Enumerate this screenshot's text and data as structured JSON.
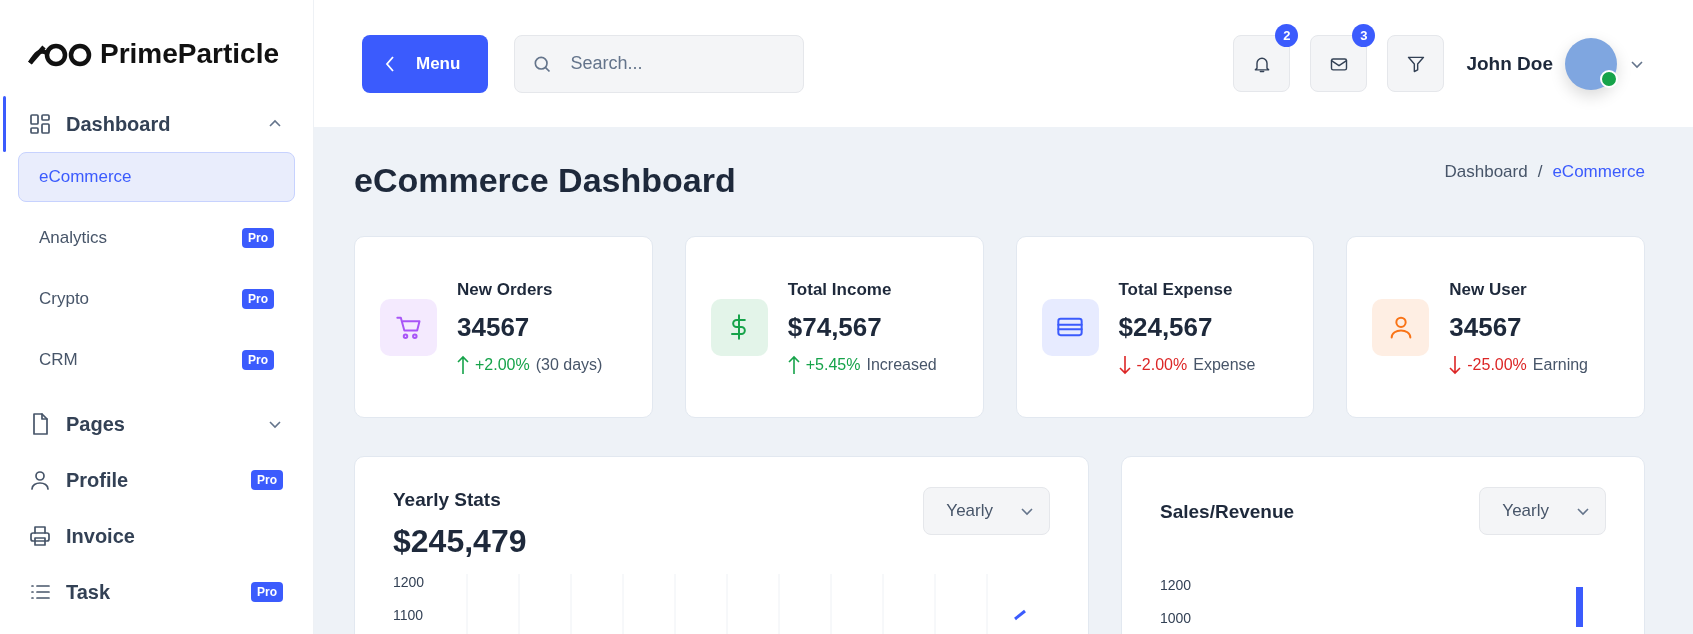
{
  "sidebar": {
    "logo": "PrimeParticle",
    "items": [
      {
        "label": "Dashboard",
        "kind": "grid",
        "expanded": true,
        "selected": false,
        "children": [
          {
            "label": "eCommerce",
            "selected": true
          },
          {
            "label": "Analytics",
            "selected": false,
            "badge": "Pro"
          },
          {
            "label": "Crypto",
            "selected": false,
            "badge": "Pro"
          },
          {
            "label": "CRM",
            "selected": false,
            "badge": "Pro"
          }
        ]
      },
      {
        "label": "Pages",
        "kind": "file",
        "expanded": false,
        "selected": false
      },
      {
        "label": "Profile",
        "kind": "user",
        "selected": false,
        "badge": "Pro"
      },
      {
        "label": "Invoice",
        "kind": "printer",
        "selected": false
      },
      {
        "label": "Task",
        "kind": "list",
        "selected": false,
        "badge": "Pro"
      }
    ]
  },
  "header": {
    "menu_button": "Menu",
    "search": {
      "placeholder": "Search..."
    },
    "icons": [
      {
        "kind": "bell",
        "badge": "2"
      },
      {
        "kind": "mail",
        "badge": "3"
      },
      {
        "kind": "filter"
      }
    ],
    "user": {
      "name": "John Doe",
      "online": true
    }
  },
  "page": {
    "title": "eCommerce Dashboard",
    "breadcrumb": [
      {
        "label": "Dashboard",
        "selected": false
      },
      {
        "label": "/",
        "selected": false
      },
      {
        "label": "eCommerce",
        "selected": true
      }
    ]
  },
  "stats": [
    {
      "title": "New Orders",
      "value": "34567",
      "kind": "cart",
      "color": "#a855f7",
      "rising": true,
      "change": "+2.00%",
      "note": "(30 days)"
    },
    {
      "title": "Total Income",
      "value": "$74,567",
      "kind": "dollar",
      "color": "#16a34a",
      "rising": true,
      "change": "+5.45%",
      "note": "Increased"
    },
    {
      "title": "Total Expense",
      "value": "$24,567",
      "kind": "card",
      "color": "#3b5bfd",
      "rising": false,
      "change": "-2.00%",
      "note": "Expense"
    },
    {
      "title": "New User",
      "value": "34567",
      "kind": "user",
      "color": "#f97316",
      "rising": false,
      "change": "-25.00%",
      "note": "Earning"
    }
  ],
  "panels": [
    {
      "kind": "line",
      "title": "Yearly Stats",
      "total": "$245,479",
      "period": "Yearly",
      "axis_labels": [
        "1200",
        "1100"
      ]
    },
    {
      "kind": "bar",
      "title": "Sales/Revenue",
      "period": "Yearly",
      "axis_labels": [
        "1200",
        "1000"
      ]
    }
  ]
}
